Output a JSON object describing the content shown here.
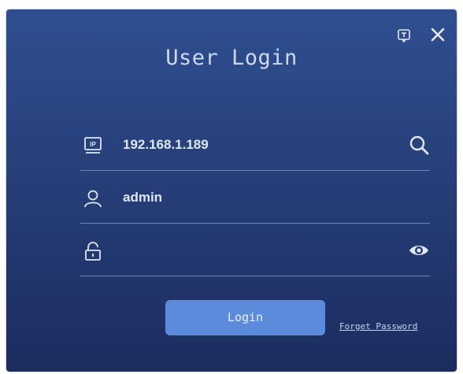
{
  "dialog": {
    "title": "User Login",
    "icons": {
      "feedback": "feedback-icon",
      "close": "close-icon"
    }
  },
  "fields": {
    "ip": {
      "icon": "ip-icon",
      "value": "192.168.1.189",
      "action_icon": "search-icon"
    },
    "username": {
      "icon": "user-icon",
      "value": "admin"
    },
    "password": {
      "icon": "lock-icon",
      "value": "",
      "action_icon": "eye-icon"
    }
  },
  "actions": {
    "login_label": "Login",
    "forget_label": "Forget Password"
  },
  "colors": {
    "background_top": "#2f4f90",
    "background_bottom": "#1c2c5e",
    "button": "#5d8bdc",
    "text": "#dfe7f7"
  }
}
